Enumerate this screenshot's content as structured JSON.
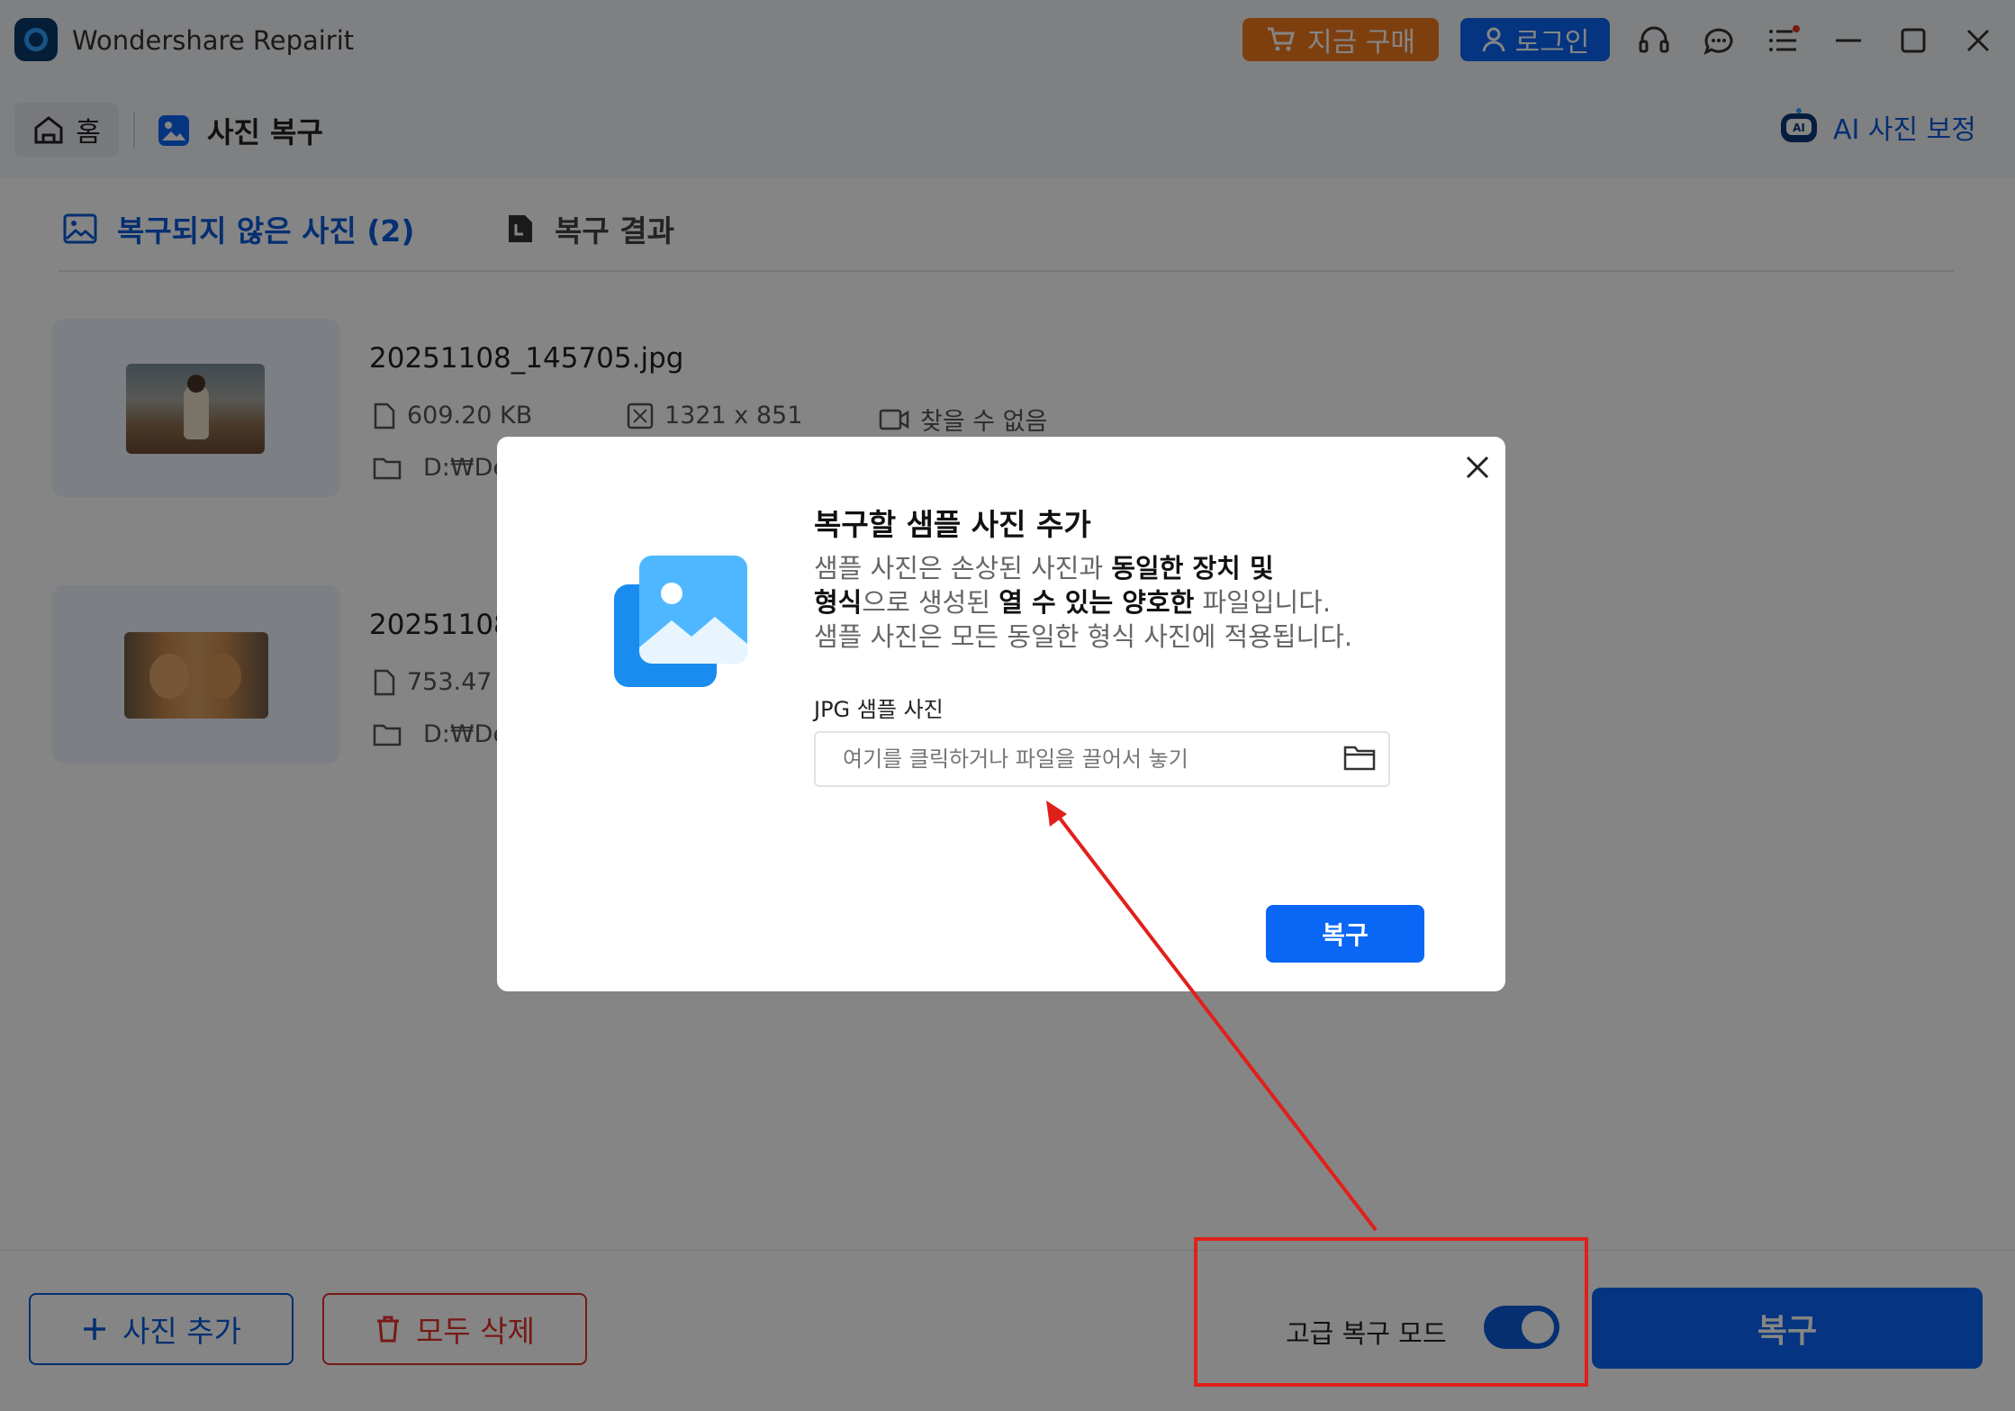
{
  "app": {
    "title": "Wondershare Repairit",
    "buy_label": "지금 구매",
    "login_label": "로그인",
    "window_icons": [
      "headset-icon",
      "chat-icon",
      "menu-list-icon",
      "minimize-icon",
      "maximize-icon",
      "close-icon"
    ]
  },
  "nav": {
    "home_label": "홈",
    "section_label": "사진 복구",
    "ai_label": "AI 사진 보정"
  },
  "tabs": [
    {
      "label": "복구되지 않은 사진 (2)",
      "active": true
    },
    {
      "label": "복구 결과",
      "active": false
    }
  ],
  "files": [
    {
      "name": "20251108_145705.jpg",
      "size": "609.20 KB",
      "resolution": "1321 x 851",
      "camera": "찾을 수 없음",
      "path": "D:₩De"
    },
    {
      "name": "20251108",
      "size": "753.47",
      "path": "D:₩De"
    }
  ],
  "bottom": {
    "add_label": "사진 추가",
    "delete_label": "모두 삭제",
    "advanced_label": "고급 복구 모드",
    "advanced_on": true,
    "recover_label": "복구"
  },
  "modal": {
    "title": "복구할 샘플 사진 추가",
    "desc_1": "샘플 사진은 손상된 사진과 ",
    "desc_1b": "동일한 장치 및",
    "desc_2b": "형식",
    "desc_2": "으로 생성된 ",
    "desc_2c": "열 수 있는 양호한",
    "desc_2d": " 파일입니다.",
    "desc_3": "샘플 사진은 모든 동일한 형식 사진에 적용됩니다.",
    "field_label": "JPG 샘플 사진",
    "field_placeholder": "여기를 클릭하거나 파일을 끌어서 놓기",
    "recover_label": "복구"
  },
  "colors": {
    "accent": "#0a66f5",
    "danger": "#e3322b",
    "buy": "#f27a1d",
    "annotation": "#e0201a"
  }
}
